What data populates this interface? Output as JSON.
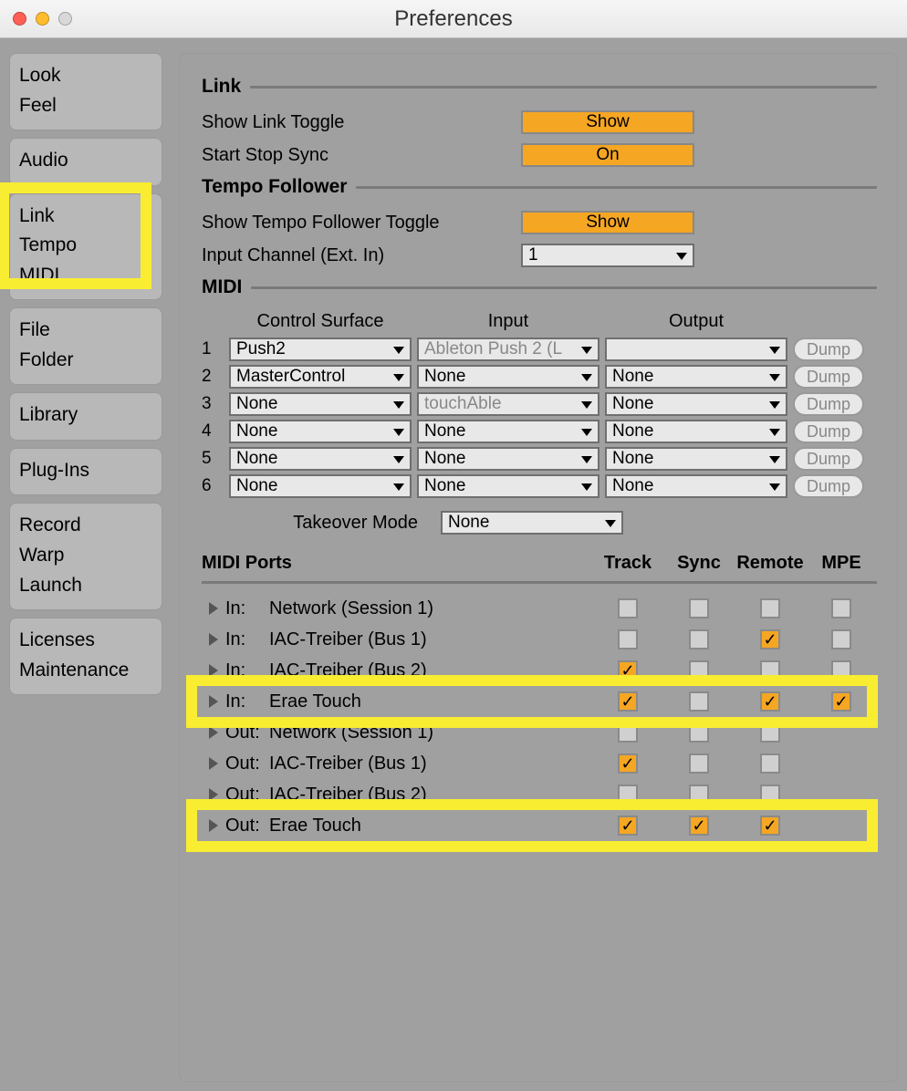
{
  "window": {
    "title": "Preferences"
  },
  "sidebar": [
    {
      "lines": [
        "Look",
        "Feel"
      ]
    },
    {
      "lines": [
        "Audio"
      ]
    },
    {
      "lines": [
        "Link",
        "Tempo",
        "MIDI"
      ],
      "highlighted": true
    },
    {
      "lines": [
        "File",
        "Folder"
      ]
    },
    {
      "lines": [
        "Library"
      ]
    },
    {
      "lines": [
        "Plug-Ins"
      ]
    },
    {
      "lines": [
        "Record",
        "Warp",
        "Launch"
      ]
    },
    {
      "lines": [
        "Licenses",
        "Maintenance"
      ]
    }
  ],
  "sections": {
    "link_title": "Link",
    "show_link_toggle_label": "Show Link Toggle",
    "show_link_toggle_value": "Show",
    "start_stop_sync_label": "Start Stop Sync",
    "start_stop_sync_value": "On",
    "tempo_follower_title": "Tempo Follower",
    "show_tempo_toggle_label": "Show Tempo Follower Toggle",
    "show_tempo_toggle_value": "Show",
    "input_channel_label": "Input Channel (Ext. In)",
    "input_channel_value": "1",
    "midi_title": "MIDI",
    "cs_headers": {
      "surface": "Control Surface",
      "input": "Input",
      "output": "Output"
    },
    "control_surfaces": [
      {
        "n": "1",
        "surface": "Push2",
        "input": "Ableton Push 2 (L",
        "input_grey": true,
        "output": "",
        "dump": "Dump"
      },
      {
        "n": "2",
        "surface": "MasterControl",
        "input": "None",
        "output": "None",
        "dump": "Dump"
      },
      {
        "n": "3",
        "surface": "None",
        "input": "touchAble",
        "input_grey": true,
        "output": "None",
        "dump": "Dump"
      },
      {
        "n": "4",
        "surface": "None",
        "input": "None",
        "output": "None",
        "dump": "Dump"
      },
      {
        "n": "5",
        "surface": "None",
        "input": "None",
        "output": "None",
        "dump": "Dump"
      },
      {
        "n": "6",
        "surface": "None",
        "input": "None",
        "output": "None",
        "dump": "Dump"
      }
    ],
    "takeover_label": "Takeover Mode",
    "takeover_value": "None",
    "midi_ports_title": "MIDI Ports",
    "port_cols": {
      "track": "Track",
      "sync": "Sync",
      "remote": "Remote",
      "mpe": "MPE"
    },
    "ports": [
      {
        "dir": "In:",
        "name": "Network (Session 1)",
        "track": false,
        "sync": false,
        "remote": false,
        "mpe": false
      },
      {
        "dir": "In:",
        "name": "IAC-Treiber (Bus 1)",
        "track": false,
        "sync": false,
        "remote": true,
        "mpe": false
      },
      {
        "dir": "In:",
        "name": "IAC-Treiber (Bus 2)",
        "track": true,
        "sync": false,
        "remote": false,
        "mpe": false
      },
      {
        "dir": "In:",
        "name": "Erae Touch",
        "track": true,
        "sync": false,
        "remote": true,
        "mpe": true,
        "highlighted": true
      },
      {
        "dir": "Out:",
        "name": "Network (Session 1)",
        "track": false,
        "sync": false,
        "remote": false,
        "mpe": null
      },
      {
        "dir": "Out:",
        "name": "IAC-Treiber (Bus 1)",
        "track": true,
        "sync": false,
        "remote": false,
        "mpe": null
      },
      {
        "dir": "Out:",
        "name": "IAC-Treiber (Bus 2)",
        "track": false,
        "sync": false,
        "remote": false,
        "mpe": null
      },
      {
        "dir": "Out:",
        "name": "Erae Touch",
        "track": true,
        "sync": true,
        "remote": true,
        "mpe": null,
        "highlighted": true
      }
    ]
  }
}
